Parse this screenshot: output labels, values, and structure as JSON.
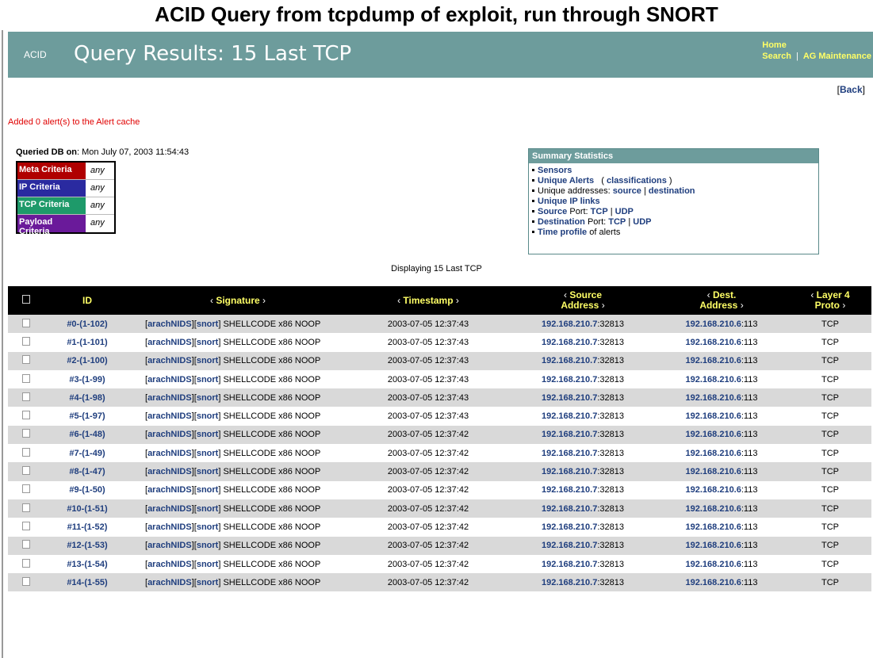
{
  "slide_title": "ACID Query from tcpdump of exploit, run through SNORT",
  "header": {
    "app_tag": "ACID",
    "heading": "Query Results: 15 Last TCP",
    "links": {
      "home": "Home",
      "search": "Search",
      "sep": "|",
      "maintenance": "AG Maintenance"
    }
  },
  "back": {
    "open": "[",
    "label": "Back",
    "close": "]"
  },
  "cache_message": "Added 0 alert(s) to the Alert cache",
  "queried": {
    "label": "Queried DB on",
    "value": ": Mon July 07, 2003 11:54:43"
  },
  "criteria": [
    {
      "label": "Meta Criteria",
      "value": "any",
      "color": "#b00000"
    },
    {
      "label": "IP Criteria",
      "value": "any",
      "color": "#2a2aa0"
    },
    {
      "label": "TCP Criteria",
      "value": "any",
      "color": "#1e9a6a"
    },
    {
      "label": "Payload Criteria",
      "value": "any",
      "color": "#6a1a9a"
    }
  ],
  "summary": {
    "title": "Summary Statistics",
    "sensors": "Sensors",
    "unique_alerts": "Unique Alerts",
    "paren_open": "(",
    "classifications": "classifications",
    "paren_close": ")",
    "unique_addresses": "Unique addresses:",
    "source": "source",
    "sep": "|",
    "destination": "destination",
    "unique_ip_links": "Unique IP links",
    "source_word": "Source",
    "port": "Port:",
    "tcp": "TCP",
    "udp": "UDP",
    "destination_word": "Destination",
    "time_profile": "Time profile",
    "of_alerts": "of alerts"
  },
  "displaying": "Displaying 15 Last TCP",
  "table": {
    "headers": {
      "id": "ID",
      "signature": "Signature",
      "timestamp": "Timestamp",
      "source_1": "Source",
      "source_2": "Address",
      "dest_1": "Dest.",
      "dest_2": "Address",
      "proto_1": "Layer 4",
      "proto_2": "Proto",
      "arrow_left": "‹",
      "arrow_right": "›"
    },
    "sig_prefix": {
      "open1": "[",
      "arach": "arachNIDS",
      "close1": "]",
      "open2": "[",
      "snort": "snort",
      "close2": "]"
    },
    "rows": [
      {
        "id": "#0-(1-102)",
        "sig": "SHELLCODE x86 NOOP",
        "ts": "2003-07-05 12:37:43",
        "src_ip": "192.168.210.7",
        "src_port": ":32813",
        "dst_ip": "192.168.210.6",
        "dst_port": ":113",
        "proto": "TCP"
      },
      {
        "id": "#1-(1-101)",
        "sig": "SHELLCODE x86 NOOP",
        "ts": "2003-07-05 12:37:43",
        "src_ip": "192.168.210.7",
        "src_port": ":32813",
        "dst_ip": "192.168.210.6",
        "dst_port": ":113",
        "proto": "TCP"
      },
      {
        "id": "#2-(1-100)",
        "sig": "SHELLCODE x86 NOOP",
        "ts": "2003-07-05 12:37:43",
        "src_ip": "192.168.210.7",
        "src_port": ":32813",
        "dst_ip": "192.168.210.6",
        "dst_port": ":113",
        "proto": "TCP"
      },
      {
        "id": "#3-(1-99)",
        "sig": "SHELLCODE x86 NOOP",
        "ts": "2003-07-05 12:37:43",
        "src_ip": "192.168.210.7",
        "src_port": ":32813",
        "dst_ip": "192.168.210.6",
        "dst_port": ":113",
        "proto": "TCP"
      },
      {
        "id": "#4-(1-98)",
        "sig": "SHELLCODE x86 NOOP",
        "ts": "2003-07-05 12:37:43",
        "src_ip": "192.168.210.7",
        "src_port": ":32813",
        "dst_ip": "192.168.210.6",
        "dst_port": ":113",
        "proto": "TCP"
      },
      {
        "id": "#5-(1-97)",
        "sig": "SHELLCODE x86 NOOP",
        "ts": "2003-07-05 12:37:43",
        "src_ip": "192.168.210.7",
        "src_port": ":32813",
        "dst_ip": "192.168.210.6",
        "dst_port": ":113",
        "proto": "TCP"
      },
      {
        "id": "#6-(1-48)",
        "sig": "SHELLCODE x86 NOOP",
        "ts": "2003-07-05 12:37:42",
        "src_ip": "192.168.210.7",
        "src_port": ":32813",
        "dst_ip": "192.168.210.6",
        "dst_port": ":113",
        "proto": "TCP"
      },
      {
        "id": "#7-(1-49)",
        "sig": "SHELLCODE x86 NOOP",
        "ts": "2003-07-05 12:37:42",
        "src_ip": "192.168.210.7",
        "src_port": ":32813",
        "dst_ip": "192.168.210.6",
        "dst_port": ":113",
        "proto": "TCP"
      },
      {
        "id": "#8-(1-47)",
        "sig": "SHELLCODE x86 NOOP",
        "ts": "2003-07-05 12:37:42",
        "src_ip": "192.168.210.7",
        "src_port": ":32813",
        "dst_ip": "192.168.210.6",
        "dst_port": ":113",
        "proto": "TCP"
      },
      {
        "id": "#9-(1-50)",
        "sig": "SHELLCODE x86 NOOP",
        "ts": "2003-07-05 12:37:42",
        "src_ip": "192.168.210.7",
        "src_port": ":32813",
        "dst_ip": "192.168.210.6",
        "dst_port": ":113",
        "proto": "TCP"
      },
      {
        "id": "#10-(1-51)",
        "sig": "SHELLCODE x86 NOOP",
        "ts": "2003-07-05 12:37:42",
        "src_ip": "192.168.210.7",
        "src_port": ":32813",
        "dst_ip": "192.168.210.6",
        "dst_port": ":113",
        "proto": "TCP"
      },
      {
        "id": "#11-(1-52)",
        "sig": "SHELLCODE x86 NOOP",
        "ts": "2003-07-05 12:37:42",
        "src_ip": "192.168.210.7",
        "src_port": ":32813",
        "dst_ip": "192.168.210.6",
        "dst_port": ":113",
        "proto": "TCP"
      },
      {
        "id": "#12-(1-53)",
        "sig": "SHELLCODE x86 NOOP",
        "ts": "2003-07-05 12:37:42",
        "src_ip": "192.168.210.7",
        "src_port": ":32813",
        "dst_ip": "192.168.210.6",
        "dst_port": ":113",
        "proto": "TCP"
      },
      {
        "id": "#13-(1-54)",
        "sig": "SHELLCODE x86 NOOP",
        "ts": "2003-07-05 12:37:42",
        "src_ip": "192.168.210.7",
        "src_port": ":32813",
        "dst_ip": "192.168.210.6",
        "dst_port": ":113",
        "proto": "TCP"
      },
      {
        "id": "#14-(1-55)",
        "sig": "SHELLCODE x86 NOOP",
        "ts": "2003-07-05 12:37:42",
        "src_ip": "192.168.210.7",
        "src_port": ":32813",
        "dst_ip": "192.168.210.6",
        "dst_port": ":113",
        "proto": "TCP"
      }
    ]
  },
  "colors": {
    "header_bg": "#6d9c9c",
    "link": "#1f3e7e",
    "header_link": "#ffff66",
    "alert_text": "#e00000",
    "row_alt": "#d9d9d9"
  }
}
